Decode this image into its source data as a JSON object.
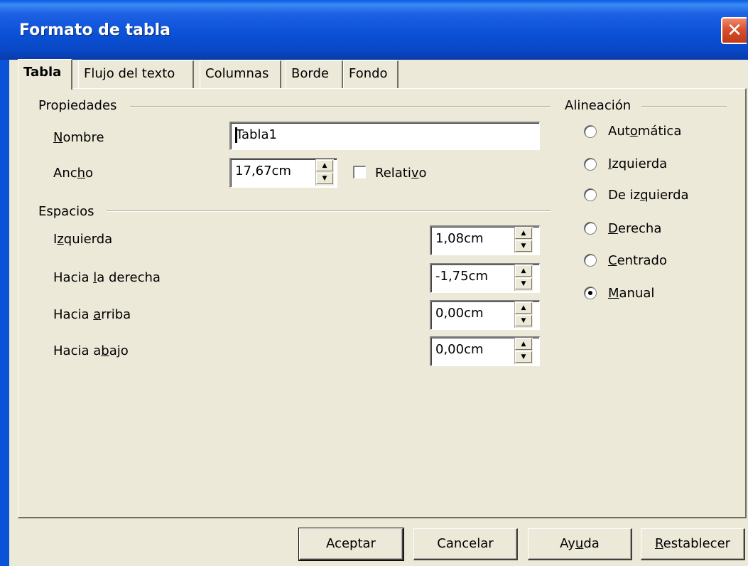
{
  "window": {
    "title": "Formato de tabla",
    "close_icon": "close-icon"
  },
  "tabs": [
    {
      "label": "Tabla",
      "active": true
    },
    {
      "label": "Flujo del texto"
    },
    {
      "label": "Columnas"
    },
    {
      "label": "Borde"
    },
    {
      "label": "Fondo"
    }
  ],
  "propiedades": {
    "header": "Propiedades",
    "nombre_label": "Nombre",
    "nombre_value": "Tabla1",
    "ancho_label": "Ancho",
    "ancho_value": "17,67cm",
    "relativo_label": "Relativo",
    "relativo_checked": false
  },
  "espacios": {
    "header": "Espacios",
    "rows": [
      {
        "label": "Izquierda",
        "value": "1,08cm"
      },
      {
        "label": "Hacia la derecha",
        "value": "-1,75cm"
      },
      {
        "label": "Hacia arriba",
        "value": "0,00cm"
      },
      {
        "label": "Hacia abajo",
        "value": "0,00cm"
      }
    ]
  },
  "alineacion": {
    "header": "Alineación",
    "options": [
      {
        "label": "Automática"
      },
      {
        "label": "Izquierda"
      },
      {
        "label": "De izquierda"
      },
      {
        "label": "Derecha"
      },
      {
        "label": "Centrado"
      },
      {
        "label": "Manual",
        "selected": true
      }
    ]
  },
  "buttons": {
    "ok": "Aceptar",
    "cancel": "Cancelar",
    "help": "Ayuda",
    "reset": "Restablecer"
  },
  "colors": {
    "titlebar": "#0a52d8",
    "dialog_bg": "#ece9d8",
    "close": "#d8502e"
  }
}
